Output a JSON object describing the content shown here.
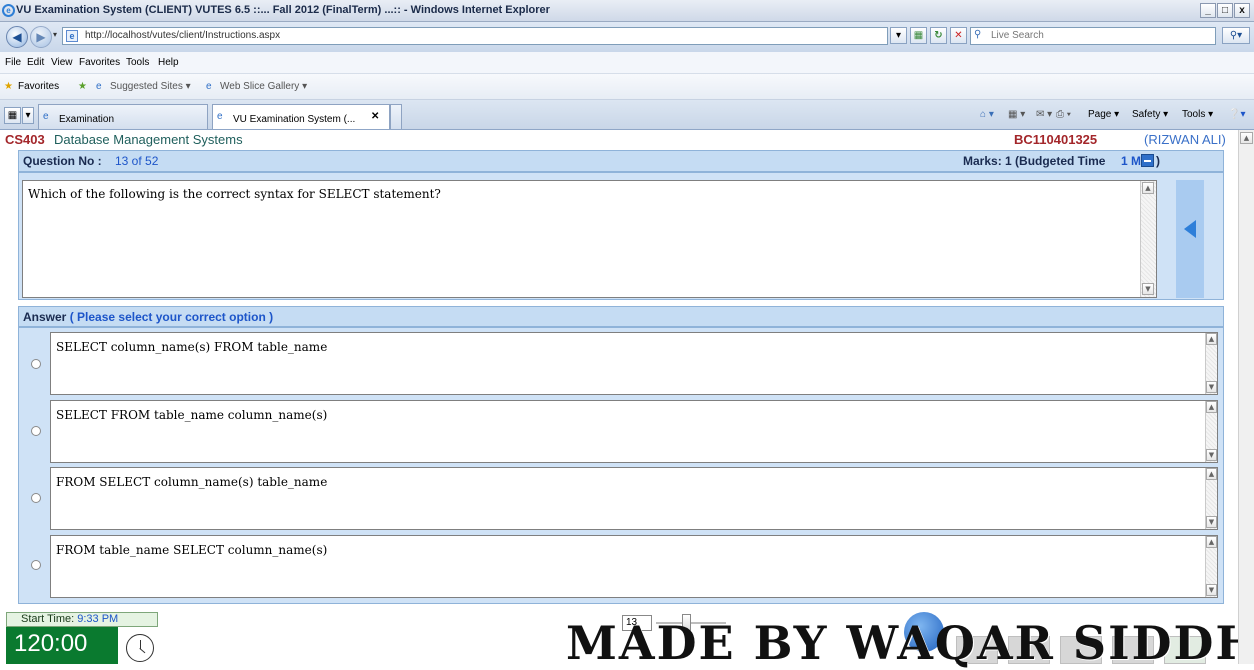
{
  "window": {
    "title": "VU Examination System (CLIENT) VUTES 6.5 ::... Fall 2012 (FinalTerm) ...:: - Windows Internet Explorer",
    "min": "_",
    "max": "□",
    "close": "x"
  },
  "address": {
    "url": "http://localhost/vutes/client/Instructions.aspx",
    "search_placeholder": "Live Search"
  },
  "menu": [
    "File",
    "Edit",
    "View",
    "Favorites",
    "Tools",
    "Help"
  ],
  "favorites": {
    "label": "Favorites",
    "items": [
      "Suggested Sites ▾",
      "Web Slice Gallery ▾"
    ]
  },
  "tabs": [
    {
      "label": "Examination"
    },
    {
      "label": "VU Examination System (...",
      "close": "✕"
    }
  ],
  "command_bar": [
    "Page ▾",
    "Safety ▾",
    "Tools ▾"
  ],
  "course": {
    "code": "CS403",
    "name": "Database Management Systems",
    "student_id": "BC110401325",
    "student_name": "(RIZWAN ALI)"
  },
  "question": {
    "label": "Question No :",
    "number": "13 of 52",
    "marks_label": "Marks: 1 (Budgeted Time ",
    "time": "1 Min",
    "marks_close": ")",
    "text": "Which of the following is the correct syntax for SELECT statement?"
  },
  "answer": {
    "label": "Answer",
    "hint": "( Please select your correct option )",
    "options": [
      "SELECT column_name(s) FROM table_name",
      "SELECT FROM table_name column_name(s)",
      "FROM SELECT column_name(s) table_name",
      "FROM table_name SELECT column_name(s)"
    ]
  },
  "footer": {
    "start_label": "Start Time:",
    "start_time": "9:33 PM",
    "timer": "120:00",
    "page_input": "13",
    "watermark": "MADE BY WAQAR SIDDHU"
  }
}
